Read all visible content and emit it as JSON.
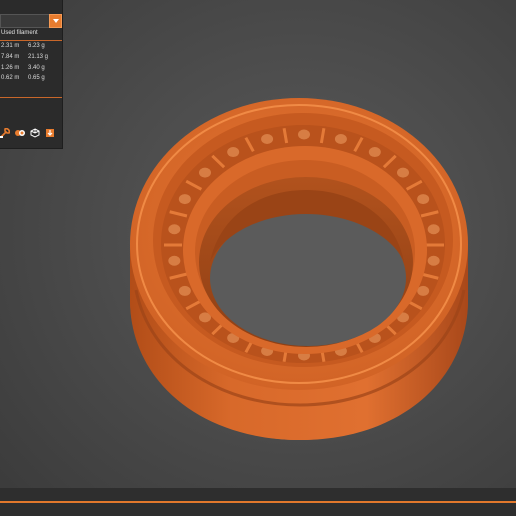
{
  "slice_panel": {
    "column_header": "Used filament",
    "rows": [
      {
        "length": "2.31 m",
        "weight": "6.23 g"
      },
      {
        "length": "7.84 m",
        "weight": "21.13 g"
      },
      {
        "length": "1.26 m",
        "weight": "3.40 g"
      },
      {
        "length": "0.62 m",
        "weight": "0.65 g"
      }
    ]
  },
  "toolbar": {
    "icons": [
      "settings-wrench-icon",
      "pattern-icon",
      "cube-icon",
      "export-icon"
    ]
  },
  "colors": {
    "accent": "#e87c2e",
    "model": "#d9672a",
    "panel": "#2b2b2b",
    "background": "#4c4c4c"
  }
}
